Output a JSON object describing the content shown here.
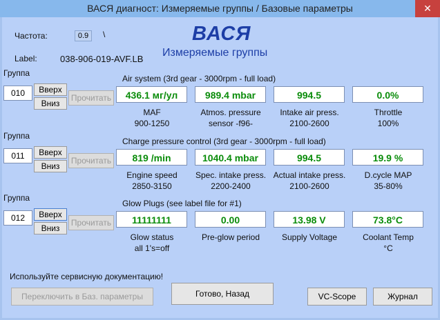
{
  "window": {
    "title": "ВАСЯ диагност: Измеряемые группы / Базовые параметры",
    "close": "✕"
  },
  "header": {
    "freq_label": "Частота:",
    "freq_value": "0.9",
    "freq_slash": "\\",
    "label_label": "Label:",
    "label_value": "038-906-019-AVF.LB",
    "app_name": "ВАСЯ",
    "mode": "Измеряемые группы"
  },
  "groups": [
    {
      "group_label": "Группа",
      "number": "010",
      "up": "Вверх",
      "down": "Вниз",
      "read": "Прочитать",
      "title": "Air system (3rd gear - 3000rpm - full load)",
      "values": [
        "436.1 мг/ул",
        "989.4 mbar",
        "994.5",
        "0.0%"
      ],
      "captions": [
        [
          "MAF",
          "900-1250"
        ],
        [
          "Atmos. pressure",
          "sensor -f96-"
        ],
        [
          "Intake air press.",
          "2100-2600"
        ],
        [
          "Throttle",
          "100%"
        ]
      ]
    },
    {
      "group_label": "Группа",
      "number": "011",
      "up": "Вверх",
      "down": "Вниз",
      "read": "Прочитать",
      "title": "Charge pressure control (3rd gear - 3000rpm - full load)",
      "values": [
        "819 /min",
        "1040.4 mbar",
        "994.5",
        "19.9 %"
      ],
      "captions": [
        [
          "Engine speed",
          "2850-3150"
        ],
        [
          "Spec. intake press.",
          "2200-2400"
        ],
        [
          "Actual intake press.",
          "2100-2600"
        ],
        [
          "D.cycle MAP",
          "35-80%"
        ]
      ]
    },
    {
      "group_label": "Группа",
      "number": "012",
      "up": "Вверх",
      "down": "Вниз",
      "read": "Прочитать",
      "title": "Glow Plugs (see label file for #1)",
      "values": [
        "11111111",
        "0.00",
        "13.98 V",
        "73.8°C"
      ],
      "captions": [
        [
          "Glow status",
          "all 1's=off"
        ],
        [
          "Pre-glow period",
          ""
        ],
        [
          "Supply Voltage",
          ""
        ],
        [
          "Coolant Temp",
          "°C"
        ]
      ]
    }
  ],
  "footer": {
    "note": "Используйте сервисную документацию!",
    "switch_btn": "Переключить в Баз. параметры",
    "done_btn": "Готово, Назад",
    "vcscope_btn": "VC-Scope",
    "log_btn": "Журнал"
  }
}
